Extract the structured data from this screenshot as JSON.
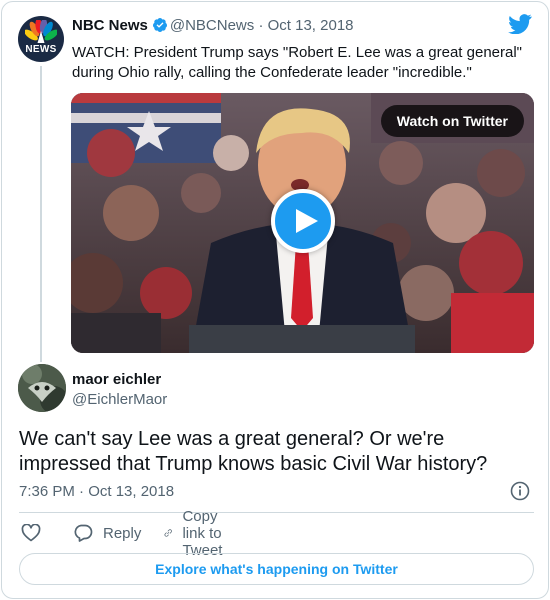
{
  "quoted_tweet": {
    "author_name": "NBC News",
    "author_handle": "@NBCNews",
    "separator": "·",
    "date": "Oct 13, 2018",
    "avatar_icon": "nbc-peacock-icon",
    "avatar_text": "NEWS",
    "text": "WATCH: President Trump says \"Robert E. Lee was a great general\" during Ohio rally, calling the Confederate leader \"incredible.\"",
    "media": {
      "watch_label": "Watch on Twitter",
      "play_icon": "play-icon"
    }
  },
  "tweet": {
    "author_name": "maor eichler",
    "author_handle": "@EichlerMaor",
    "text": "We can't say Lee was a great general? Or we're impressed that Trump knows basic Civil War history?",
    "timestamp": "7:36 PM · Oct 13, 2018"
  },
  "actions": {
    "like_icon": "heart-icon",
    "reply_label": "Reply",
    "copy_link_label": "Copy link to Tweet"
  },
  "footer": {
    "explore_label": "Explore what's happening on Twitter"
  },
  "colors": {
    "accent": "#1d9bf0",
    "text_primary": "#0f1419",
    "text_secondary": "#536471",
    "border": "#cfd9de"
  }
}
